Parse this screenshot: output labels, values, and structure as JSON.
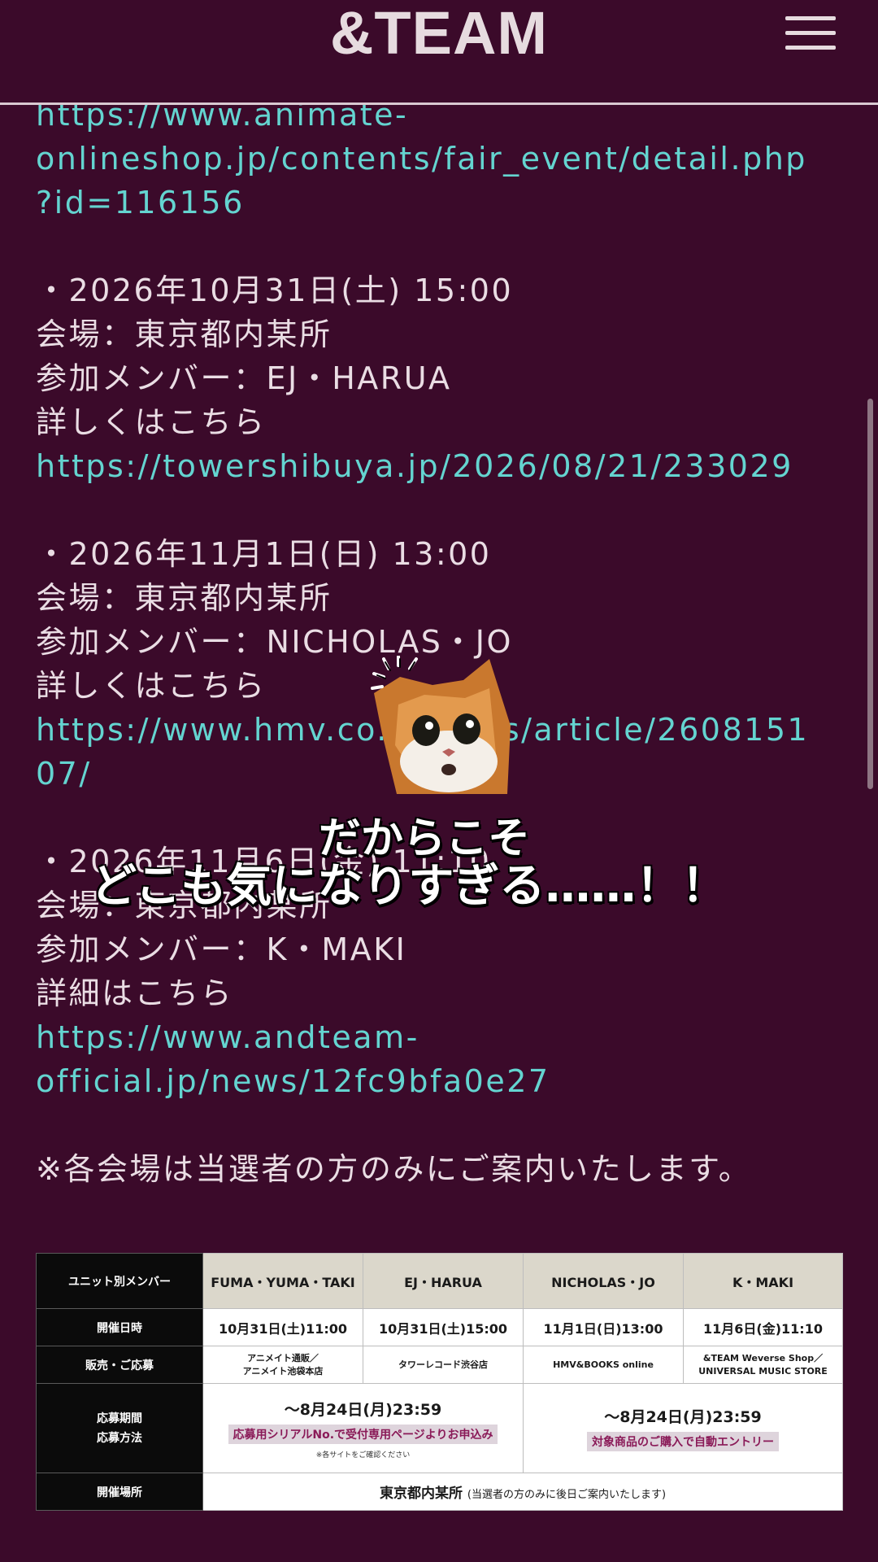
{
  "header": {
    "logo": "&TEAM",
    "menu_icon": "hamburger-menu-icon"
  },
  "content": {
    "lines_a": [
      {
        "text": "https://www.animate-",
        "link": true
      },
      {
        "text": "onlineshop.jp/contents/fair_event/detail.php",
        "link": true
      },
      {
        "text": "?id=116156",
        "link": true
      }
    ],
    "event2": {
      "date": "・2026年10月31日(土) 15:00",
      "venue": "会場：東京都内某所",
      "members": "参加メンバー：EJ・HARUA",
      "details": "詳しくはこちら",
      "url": "https://towershibuya.jp/2026/08/21/233029"
    },
    "event3": {
      "date": "・2026年11月1日(日) 13:00",
      "venue": "会場：東京都内某所",
      "members": "参加メンバー：NICHOLAS・JO",
      "details": "詳しくはこちら",
      "url1": "https://www.hmv.co.jp/news/article/2608151",
      "url2": "07/"
    },
    "event4": {
      "date": "・2026年11月6日(金) 11:10",
      "venue": "会場：東京都内某所",
      "members": "参加メンバー：K・MAKI",
      "details": "詳細はこちら",
      "url1": "https://www.andteam-",
      "url2": "official.jp/news/12fc9bfa0e27"
    },
    "notice": "※各会場は当選者の方のみにご案内いたします。"
  },
  "overlay": {
    "caption1": "だからこそ",
    "caption2": "どこも気になりすぎる……！！",
    "sticker": "surprised-cat-sticker"
  },
  "table": {
    "row_headers": [
      "ユニット別メンバー",
      "開催日時",
      "販売・ご応募",
      "応募期間\n応募方法",
      "開催場所"
    ],
    "members": [
      "FUMA・YUMA・TAKI",
      "EJ・HARUA",
      "NICHOLAS・JO",
      "K・MAKI"
    ],
    "dates": [
      "10月31日(土)11:00",
      "10月31日(土)15:00",
      "11月1日(日)13:00",
      "11月6日(金)11:10"
    ],
    "shops": [
      "アニメイト通販／\nアニメイト池袋本店",
      "タワーレコード渋谷店",
      "HMV&BOOKS online",
      "&TEAM Weverse Shop／\nUNIVERSAL MUSIC STORE"
    ],
    "period_left": "～8月24日(月)23:59",
    "method_left": "応募用シリアルNo.で受付専用ページよりお申込み",
    "note_left": "※各サイトをご確認ください",
    "period_right": "～8月24日(月)23:59",
    "method_right": "対象商品のご購入で自動エントリー",
    "venue": "東京都内某所",
    "venue_note": "(当選者の方のみに後日ご案内いたします)"
  }
}
